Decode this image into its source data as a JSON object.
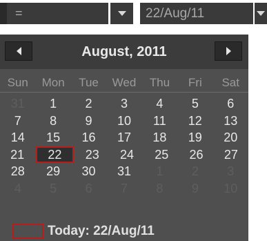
{
  "filter": {
    "operator_value": "=",
    "date_value": "22/Aug/11"
  },
  "calendar": {
    "month_title": "August, 2011",
    "weekdays": [
      "Sun",
      "Mon",
      "Tue",
      "Wed",
      "Thu",
      "Fri",
      "Sat"
    ],
    "weeks": [
      [
        {
          "d": "31",
          "o": true
        },
        {
          "d": "1"
        },
        {
          "d": "2"
        },
        {
          "d": "3"
        },
        {
          "d": "4"
        },
        {
          "d": "5"
        },
        {
          "d": "6"
        }
      ],
      [
        {
          "d": "7"
        },
        {
          "d": "8"
        },
        {
          "d": "9"
        },
        {
          "d": "10"
        },
        {
          "d": "11"
        },
        {
          "d": "12"
        },
        {
          "d": "13"
        }
      ],
      [
        {
          "d": "14"
        },
        {
          "d": "15"
        },
        {
          "d": "16"
        },
        {
          "d": "17"
        },
        {
          "d": "18"
        },
        {
          "d": "19"
        },
        {
          "d": "20"
        }
      ],
      [
        {
          "d": "21"
        },
        {
          "d": "22",
          "s": true
        },
        {
          "d": "23"
        },
        {
          "d": "24"
        },
        {
          "d": "25"
        },
        {
          "d": "26"
        },
        {
          "d": "27"
        }
      ],
      [
        {
          "d": "28"
        },
        {
          "d": "29"
        },
        {
          "d": "30"
        },
        {
          "d": "31"
        },
        {
          "d": "1",
          "o": true
        },
        {
          "d": "2",
          "o": true
        },
        {
          "d": "3",
          "o": true
        }
      ],
      [
        {
          "d": "4",
          "o": true
        },
        {
          "d": "5",
          "o": true
        },
        {
          "d": "6",
          "o": true
        },
        {
          "d": "7",
          "o": true
        },
        {
          "d": "8",
          "o": true
        },
        {
          "d": "9",
          "o": true
        },
        {
          "d": "10",
          "o": true
        }
      ]
    ],
    "today_label": "Today: 22/Aug/11"
  },
  "colors": {
    "panel_bg": "#4f4f4f",
    "header_bg": "#3c3c3c",
    "selected_border": "#b81d1d",
    "other_month_text": "#5e5e5e"
  },
  "icons": {
    "dropdown": "triangle-down-icon",
    "prev": "triangle-left-icon",
    "next": "triangle-right-icon"
  }
}
